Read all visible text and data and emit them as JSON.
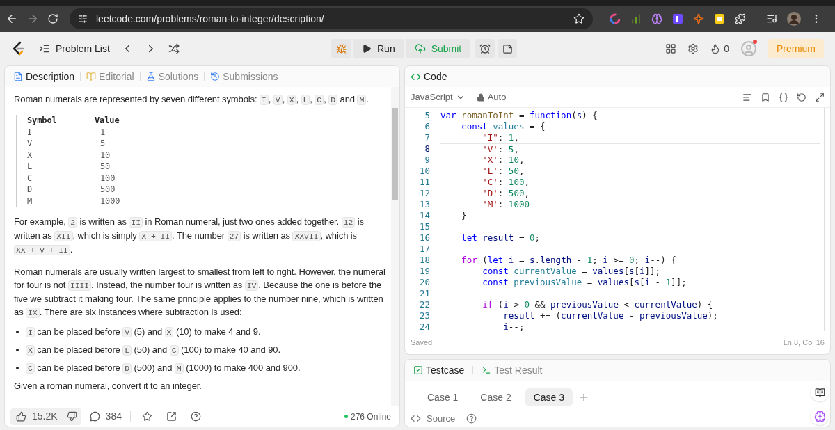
{
  "browser": {
    "url": "leetcode.com/problems/roman-to-integer/description/"
  },
  "nav": {
    "problem_list": "Problem List",
    "run": "Run",
    "submit": "Submit",
    "streak": "0",
    "notification": true,
    "premium": "Premium"
  },
  "description_panel": {
    "tabs": [
      {
        "label": "Description",
        "selected": true
      },
      {
        "label": "Editorial",
        "selected": false
      },
      {
        "label": "Solutions",
        "selected": false
      },
      {
        "label": "Submissions",
        "selected": false
      }
    ],
    "intro": [
      {
        "kind": "text",
        "text": "Roman numerals are represented by seven different symbols: "
      },
      {
        "kind": "code",
        "text": "I"
      },
      {
        "kind": "text",
        "text": ", "
      },
      {
        "kind": "code",
        "text": "V"
      },
      {
        "kind": "text",
        "text": ", "
      },
      {
        "kind": "code",
        "text": "X"
      },
      {
        "kind": "text",
        "text": ", "
      },
      {
        "kind": "code",
        "text": "L"
      },
      {
        "kind": "text",
        "text": ", "
      },
      {
        "kind": "code",
        "text": "C"
      },
      {
        "kind": "text",
        "text": ", "
      },
      {
        "kind": "code",
        "text": "D"
      },
      {
        "kind": "text",
        "text": " and "
      },
      {
        "kind": "code",
        "text": "M"
      },
      {
        "kind": "text",
        "text": "."
      }
    ],
    "table": {
      "columns": [
        "Symbol",
        "Value"
      ],
      "rows": [
        [
          "I",
          "1"
        ],
        [
          "V",
          "5"
        ],
        [
          "X",
          "10"
        ],
        [
          "L",
          "50"
        ],
        [
          "C",
          "100"
        ],
        [
          "D",
          "500"
        ],
        [
          "M",
          "1000"
        ]
      ]
    },
    "paragraphs": [
      [
        {
          "kind": "text",
          "text": "For example, "
        },
        {
          "kind": "code",
          "text": "2"
        },
        {
          "kind": "text",
          "text": " is written as "
        },
        {
          "kind": "code",
          "text": "II"
        },
        {
          "kind": "text",
          "text": " in Roman numeral, just two ones added together. "
        },
        {
          "kind": "code",
          "text": "12"
        },
        {
          "kind": "text",
          "text": " is written as "
        },
        {
          "kind": "code",
          "text": "XII"
        },
        {
          "kind": "text",
          "text": ", which is simply "
        },
        {
          "kind": "code",
          "text": "X + II"
        },
        {
          "kind": "text",
          "text": ". The number "
        },
        {
          "kind": "code",
          "text": "27"
        },
        {
          "kind": "text",
          "text": " is written as "
        },
        {
          "kind": "code",
          "text": "XXVII"
        },
        {
          "kind": "text",
          "text": ", which is "
        },
        {
          "kind": "code",
          "text": "XX + V + II"
        },
        {
          "kind": "text",
          "text": "."
        }
      ],
      [
        {
          "kind": "text",
          "text": "Roman numerals are usually written largest to smallest from left to right. However, the numeral for four is not "
        },
        {
          "kind": "code",
          "text": "IIII"
        },
        {
          "kind": "text",
          "text": ". Instead, the number four is written as "
        },
        {
          "kind": "code",
          "text": "IV"
        },
        {
          "kind": "text",
          "text": ". Because the one is before the five we subtract it making four. The same principle applies to the number nine, which is written as "
        },
        {
          "kind": "code",
          "text": "IX"
        },
        {
          "kind": "text",
          "text": ". There are six instances where subtraction is used:"
        }
      ]
    ],
    "bullets": [
      [
        {
          "kind": "code",
          "text": "I"
        },
        {
          "kind": "text",
          "text": " can be placed before "
        },
        {
          "kind": "code",
          "text": "V"
        },
        {
          "kind": "text",
          "text": " (5) and "
        },
        {
          "kind": "code",
          "text": "X"
        },
        {
          "kind": "text",
          "text": " (10) to make 4 and 9."
        }
      ],
      [
        {
          "kind": "code",
          "text": "X"
        },
        {
          "kind": "text",
          "text": " can be placed before "
        },
        {
          "kind": "code",
          "text": "L"
        },
        {
          "kind": "text",
          "text": " (50) and "
        },
        {
          "kind": "code",
          "text": "C"
        },
        {
          "kind": "text",
          "text": " (100) to make 40 and 90."
        }
      ],
      [
        {
          "kind": "code",
          "text": "C"
        },
        {
          "kind": "text",
          "text": " can be placed before "
        },
        {
          "kind": "code",
          "text": "D"
        },
        {
          "kind": "text",
          "text": " (500) and "
        },
        {
          "kind": "code",
          "text": "M"
        },
        {
          "kind": "text",
          "text": " (1000) to make 400 and 900."
        }
      ]
    ],
    "closing": [
      {
        "kind": "text",
        "text": "Given a roman numeral, convert it to an integer."
      }
    ],
    "footer": {
      "likes": "15.2K",
      "comments": "384",
      "online": "276 Online"
    }
  },
  "editor": {
    "tab": "Code",
    "language": "JavaScript",
    "mode": "Auto",
    "status": "Saved",
    "cursor": "Ln 8, Col 16",
    "lines": [
      {
        "number": "5",
        "current": false,
        "tokens": [
          {
            "kind": "keyword",
            "text": "var"
          },
          {
            "kind": "function",
            "text": " romanToInt"
          },
          {
            "kind": "plain",
            "text": " = "
          },
          {
            "kind": "keyword",
            "text": "function"
          },
          {
            "kind": "plain",
            "text": "("
          },
          {
            "kind": "variable",
            "text": "s"
          },
          {
            "kind": "plain",
            "text": ") {"
          }
        ]
      },
      {
        "number": "6",
        "current": false,
        "tokens": [
          {
            "kind": "keyword",
            "text": "    const"
          },
          {
            "kind": "property",
            "text": " values"
          },
          {
            "kind": "plain",
            "text": " = {"
          }
        ]
      },
      {
        "number": "7",
        "current": false,
        "tokens": [
          {
            "kind": "string",
            "text": "        \"I\""
          },
          {
            "kind": "plain",
            "text": ": "
          },
          {
            "kind": "number",
            "text": "1"
          },
          {
            "kind": "plain",
            "text": ","
          }
        ]
      },
      {
        "number": "8",
        "current": true,
        "tokens": [
          {
            "kind": "string",
            "text": "        'V'"
          },
          {
            "kind": "plain",
            "text": ": "
          },
          {
            "kind": "number",
            "text": "5"
          },
          {
            "kind": "plain",
            "text": ","
          }
        ]
      },
      {
        "number": "9",
        "current": false,
        "tokens": [
          {
            "kind": "string",
            "text": "        'X'"
          },
          {
            "kind": "plain",
            "text": ": "
          },
          {
            "kind": "number",
            "text": "10"
          },
          {
            "kind": "plain",
            "text": ","
          }
        ]
      },
      {
        "number": "10",
        "current": false,
        "tokens": [
          {
            "kind": "string",
            "text": "        'L'"
          },
          {
            "kind": "plain",
            "text": ": "
          },
          {
            "kind": "number",
            "text": "50"
          },
          {
            "kind": "plain",
            "text": ","
          }
        ]
      },
      {
        "number": "11",
        "current": false,
        "tokens": [
          {
            "kind": "string",
            "text": "        'C'"
          },
          {
            "kind": "plain",
            "text": ": "
          },
          {
            "kind": "number",
            "text": "100"
          },
          {
            "kind": "plain",
            "text": ","
          }
        ]
      },
      {
        "number": "12",
        "current": false,
        "tokens": [
          {
            "kind": "string",
            "text": "        'D'"
          },
          {
            "kind": "plain",
            "text": ": "
          },
          {
            "kind": "number",
            "text": "500"
          },
          {
            "kind": "plain",
            "text": ","
          }
        ]
      },
      {
        "number": "13",
        "current": false,
        "tokens": [
          {
            "kind": "string",
            "text": "        'M'"
          },
          {
            "kind": "plain",
            "text": ": "
          },
          {
            "kind": "number",
            "text": "1000"
          }
        ]
      },
      {
        "number": "14",
        "current": false,
        "tokens": [
          {
            "kind": "plain",
            "text": "    }"
          }
        ]
      },
      {
        "number": "15",
        "current": false
      },
      {
        "number": "16",
        "current": false,
        "tokens": [
          {
            "kind": "keyword",
            "text": "    let"
          },
          {
            "kind": "variable",
            "text": " result"
          },
          {
            "kind": "plain",
            "text": " = "
          },
          {
            "kind": "number",
            "text": "0"
          },
          {
            "kind": "plain",
            "text": ";"
          }
        ]
      },
      {
        "number": "17",
        "current": false
      },
      {
        "number": "18",
        "current": false,
        "tokens": [
          {
            "kind": "control",
            "text": "    for"
          },
          {
            "kind": "plain",
            "text": " ("
          },
          {
            "kind": "keyword",
            "text": "let"
          },
          {
            "kind": "variable",
            "text": " i"
          },
          {
            "kind": "plain",
            "text": " = "
          },
          {
            "kind": "variable",
            "text": "s"
          },
          {
            "kind": "plain",
            "text": "."
          },
          {
            "kind": "variable",
            "text": "length"
          },
          {
            "kind": "plain",
            "text": " - "
          },
          {
            "kind": "number",
            "text": "1"
          },
          {
            "kind": "plain",
            "text": "; "
          },
          {
            "kind": "variable",
            "text": "i"
          },
          {
            "kind": "plain",
            "text": " >= "
          },
          {
            "kind": "number",
            "text": "0"
          },
          {
            "kind": "plain",
            "text": "; "
          },
          {
            "kind": "variable",
            "text": "i"
          },
          {
            "kind": "plain",
            "text": "--) {"
          }
        ]
      },
      {
        "number": "19",
        "current": false,
        "tokens": [
          {
            "kind": "keyword",
            "text": "        const"
          },
          {
            "kind": "property",
            "text": " currentValue"
          },
          {
            "kind": "plain",
            "text": " = "
          },
          {
            "kind": "variable",
            "text": "values"
          },
          {
            "kind": "plain",
            "text": "["
          },
          {
            "kind": "variable",
            "text": "s"
          },
          {
            "kind": "plain",
            "text": "["
          },
          {
            "kind": "variable",
            "text": "i"
          },
          {
            "kind": "plain",
            "text": "]];"
          }
        ]
      },
      {
        "number": "20",
        "current": false,
        "tokens": [
          {
            "kind": "keyword",
            "text": "        const"
          },
          {
            "kind": "property",
            "text": " previousValue"
          },
          {
            "kind": "plain",
            "text": " = "
          },
          {
            "kind": "variable",
            "text": "values"
          },
          {
            "kind": "plain",
            "text": "["
          },
          {
            "kind": "variable",
            "text": "s"
          },
          {
            "kind": "plain",
            "text": "["
          },
          {
            "kind": "variable",
            "text": "i"
          },
          {
            "kind": "plain",
            "text": " - "
          },
          {
            "kind": "number",
            "text": "1"
          },
          {
            "kind": "plain",
            "text": "]];"
          }
        ]
      },
      {
        "number": "21",
        "current": false
      },
      {
        "number": "22",
        "current": false,
        "tokens": [
          {
            "kind": "control",
            "text": "        if"
          },
          {
            "kind": "plain",
            "text": " ("
          },
          {
            "kind": "variable",
            "text": "i"
          },
          {
            "kind": "plain",
            "text": " > "
          },
          {
            "kind": "number",
            "text": "0"
          },
          {
            "kind": "plain",
            "text": " && "
          },
          {
            "kind": "variable",
            "text": "previousValue"
          },
          {
            "kind": "plain",
            "text": " < "
          },
          {
            "kind": "variable",
            "text": "currentValue"
          },
          {
            "kind": "plain",
            "text": ") {"
          }
        ]
      },
      {
        "number": "23",
        "current": false,
        "tokens": [
          {
            "kind": "variable",
            "text": "            result"
          },
          {
            "kind": "plain",
            "text": " += ("
          },
          {
            "kind": "variable",
            "text": "currentValue"
          },
          {
            "kind": "plain",
            "text": " - "
          },
          {
            "kind": "variable",
            "text": "previousValue"
          },
          {
            "kind": "plain",
            "text": ");"
          }
        ]
      },
      {
        "number": "24",
        "current": false,
        "tokens": [
          {
            "kind": "variable",
            "text": "            i"
          },
          {
            "kind": "plain",
            "text": "--;"
          }
        ]
      }
    ]
  },
  "console": {
    "tabs": [
      {
        "label": "Testcase",
        "selected": true
      },
      {
        "label": "Test Result",
        "selected": false
      }
    ],
    "cases": [
      {
        "label": "Case 1",
        "selected": false
      },
      {
        "label": "Case 2",
        "selected": false
      },
      {
        "label": "Case 3",
        "selected": true
      }
    ],
    "source": "Source"
  }
}
